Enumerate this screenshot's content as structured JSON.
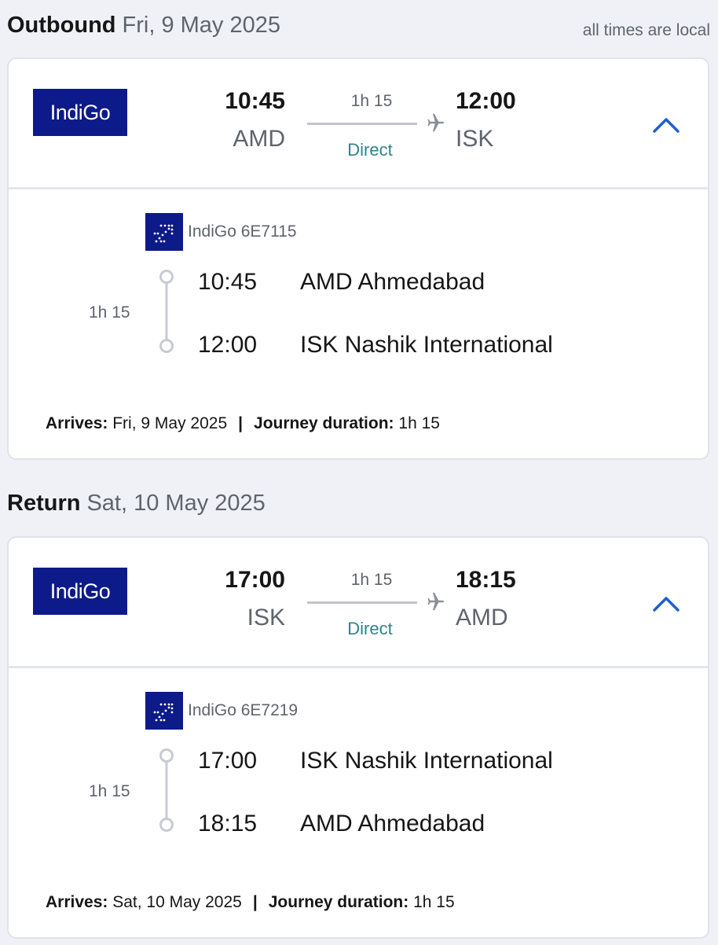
{
  "outbound": {
    "header": {
      "label": "Outbound",
      "date": "Fri, 9 May 2025",
      "note": "all times are local"
    },
    "summary": {
      "airline_logo": "IndiGo",
      "dep_time": "10:45",
      "dep_code": "AMD",
      "duration": "1h 15",
      "stops": "Direct",
      "arr_time": "12:00",
      "arr_code": "ISK"
    },
    "details": {
      "flight": "IndiGo 6E7115",
      "segment_duration": "1h 15",
      "dep_time": "10:45",
      "dep_place": "AMD Ahmedabad",
      "arr_time": "12:00",
      "arr_place": "ISK Nashik International",
      "arrives_label": "Arrives:",
      "arrives_value": "Fri, 9 May 2025",
      "separator": "|",
      "journey_label": "Journey duration:",
      "journey_value": "1h 15"
    }
  },
  "return": {
    "header": {
      "label": "Return",
      "date": "Sat, 10 May 2025"
    },
    "summary": {
      "airline_logo": "IndiGo",
      "dep_time": "17:00",
      "dep_code": "ISK",
      "duration": "1h 15",
      "stops": "Direct",
      "arr_time": "18:15",
      "arr_code": "AMD"
    },
    "details": {
      "flight": "IndiGo 6E7219",
      "segment_duration": "1h 15",
      "dep_time": "17:00",
      "dep_place": "ISK Nashik International",
      "arr_time": "18:15",
      "arr_place": "AMD Ahmedabad",
      "arrives_label": "Arrives:",
      "arrives_value": "Sat, 10 May 2025",
      "separator": "|",
      "journey_label": "Journey duration:",
      "journey_value": "1h 15"
    }
  },
  "colors": {
    "brand": "#0d1a8a",
    "accent": "#1f5fd0",
    "direct": "#2e8488",
    "muted": "#5f646d"
  },
  "icons": {
    "plane": "airplane-icon",
    "chevron": "chevron-up-icon",
    "timeline": "timeline-icon"
  }
}
